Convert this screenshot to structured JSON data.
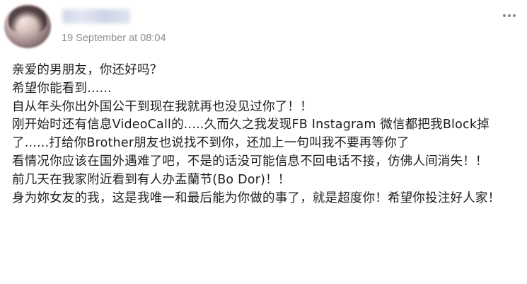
{
  "post": {
    "timestamp": "19 September at 08:04",
    "lines": [
      "亲爱的男朋友，你还好吗？",
      "希望你能看到......",
      "自从年头你出外国公干到现在我就再也没见过你了！！",
      "刚开始时还有信息VideoCall的.....久而久之我发现FB Instagram 微信都把我Block掉了......打给你Brother朋友也说找不到你，还加上一句叫我不要再等你了",
      "看情况你应该在国外遇难了吧，不是的话没可能信息不回电话不接，仿佛人间消失！！",
      "前几天在我家附近看到有人办盂蘭节(Bo Dor)！！",
      "身为妳女友的我，这是我唯一和最后能为你做的事了，就是超度你！希望你投注好人家！"
    ]
  },
  "icons": {
    "more": "more-options-icon"
  }
}
